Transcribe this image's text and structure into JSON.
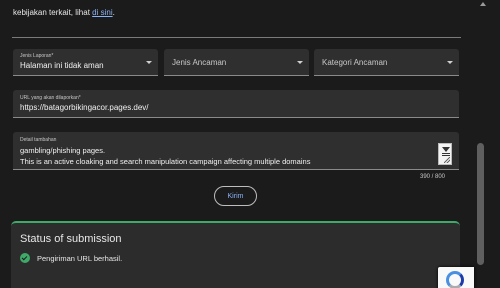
{
  "intro": {
    "text": "kebijakan terkait, lihat ",
    "link": "di sini",
    "suffix": "."
  },
  "report_type": {
    "label": "Jenis Laporan*",
    "value": "Halaman ini tidak aman"
  },
  "threat_type": {
    "placeholder": "Jenis Ancaman"
  },
  "threat_category": {
    "placeholder": "Kategori Ancaman"
  },
  "url_field": {
    "label": "URL yang akan dilaporkan*",
    "value": "https://batagorbikingacor.pages.dev/"
  },
  "details": {
    "label": "Detail tambahan",
    "line1": "gambling/phishing pages.",
    "line2": "This is an active cloaking and search manipulation campaign affecting multiple domains",
    "counter": "390 / 800"
  },
  "submit": {
    "label": "Kirim"
  },
  "status": {
    "title": "Status of submission",
    "message": "Pengiriman URL berhasil."
  },
  "colors": {
    "accent": "#8ab4f8",
    "success": "#3fa96a",
    "surface": "#2f2f2f",
    "background": "#1b1b1b"
  }
}
